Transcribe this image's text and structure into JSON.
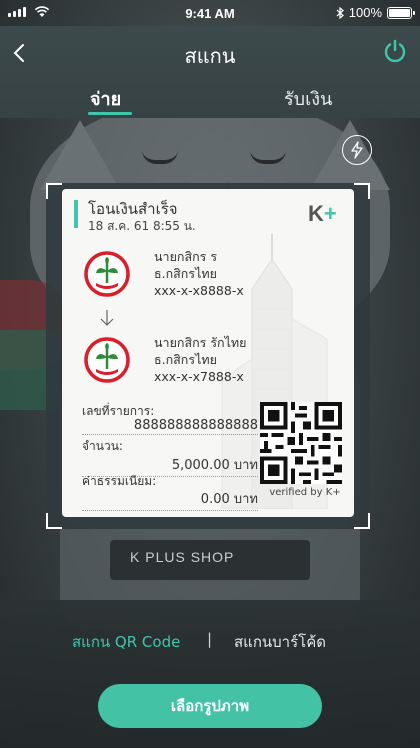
{
  "status_bar": {
    "time": "9:41 AM",
    "battery": "100%"
  },
  "header": {
    "title": "สแกน",
    "tabs": [
      {
        "label": "จ่าย",
        "active": true
      },
      {
        "label": "รับเงิน",
        "active": false
      }
    ]
  },
  "background": {
    "shop_sign": "K PLUS SHOP"
  },
  "slip": {
    "title": "โอนเงินสำเร็จ",
    "date": "18 ส.ค. 61  8:55 น.",
    "logo": {
      "k": "K",
      "plus": "+"
    },
    "sender": {
      "name": "นายกสิกร ร",
      "bank": "ธ.กสิกรไทย",
      "account": "xxx-x-x8888-x"
    },
    "receiver": {
      "name": "นายกสิกร รักไทย",
      "bank": "ธ.กสิกรไทย",
      "account": "xxx-x-x7888-x"
    },
    "ref_label": "เลขที่รายการ:",
    "ref_value": "888888888888888",
    "amount_label": "จำนวน:",
    "amount_value": "5,000.00 บาท",
    "fee_label": "ค่าธรรมเนียม:",
    "fee_value": "0.00 บาท",
    "verified": "verified by K+"
  },
  "scan_modes": {
    "qr": "สแกน QR Code",
    "separator": "|",
    "barcode": "สแกนบาร์โค้ด"
  },
  "choose_button": "เลือกรูปภาพ",
  "colors": {
    "accent": "#3fc6ac",
    "header": "#3a4648",
    "bank_red": "#d81f2a",
    "bank_green": "#2e8b3a"
  },
  "icons": {
    "back": "chevron-left-icon",
    "power": "power-icon",
    "flash": "flash-icon"
  }
}
